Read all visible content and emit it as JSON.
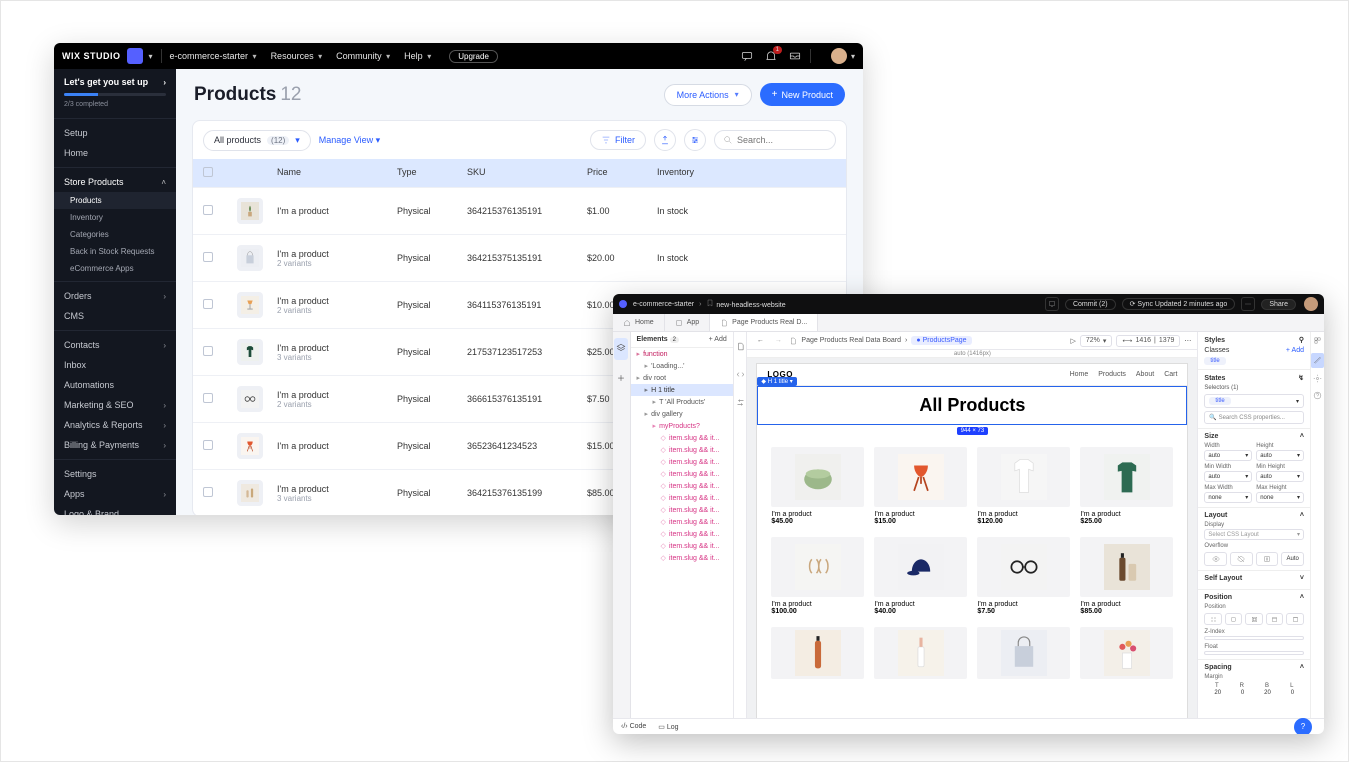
{
  "window1": {
    "topbar": {
      "logo": "WIX STUDIO",
      "project": "e-commerce-starter",
      "nav": [
        "Resources",
        "Community",
        "Help"
      ],
      "upgrade": "Upgrade",
      "notif_count": "1"
    },
    "sidebar": {
      "setup_title": "Let's get you set up",
      "setup_sub": "2/3 completed",
      "items_top": [
        "Setup",
        "Home"
      ],
      "store_products": "Store Products",
      "store_subs": [
        "Products",
        "Inventory",
        "Categories",
        "Back in Stock Requests",
        "eCommerce Apps"
      ],
      "orders": "Orders",
      "cms": "CMS",
      "group3": [
        "Contacts",
        "Inbox",
        "Automations",
        "Marketing & SEO",
        "Analytics & Reports",
        "Billing & Payments"
      ],
      "group4": [
        "Settings",
        "Apps",
        "Logo & Brand"
      ]
    },
    "main": {
      "title": "Products",
      "count": "12",
      "more_actions": "More Actions",
      "new_product": "New Product",
      "all_products": "All products",
      "all_products_count": "(12)",
      "manage_view": "Manage View",
      "filter": "Filter",
      "search_placeholder": "Search...",
      "columns": {
        "name": "Name",
        "type": "Type",
        "sku": "SKU",
        "price": "Price",
        "inventory": "Inventory"
      },
      "rows": [
        {
          "name": "I'm a product",
          "sub": "",
          "type": "Physical",
          "sku": "364215376135191",
          "price": "$1.00",
          "inv": "In stock",
          "thumb": "plant"
        },
        {
          "name": "I'm a product",
          "sub": "2 variants",
          "type": "Physical",
          "sku": "364215375135191",
          "price": "$20.00",
          "inv": "In stock",
          "thumb": "bag"
        },
        {
          "name": "I'm a product",
          "sub": "2 variants",
          "type": "Physical",
          "sku": "364115376135191",
          "price": "$10.00",
          "inv": "In stock",
          "thumb": "lamp"
        },
        {
          "name": "I'm a product",
          "sub": "3 variants",
          "type": "Physical",
          "sku": "217537123517253",
          "price": "$25.00",
          "inv": "",
          "thumb": "shirt"
        },
        {
          "name": "I'm a product",
          "sub": "2 variants",
          "type": "Physical",
          "sku": "366615376135191",
          "price": "$7.50",
          "inv": "",
          "thumb": "glasses"
        },
        {
          "name": "I'm a product",
          "sub": "",
          "type": "Physical",
          "sku": "36523641234523",
          "price": "$15.00",
          "inv": "",
          "thumb": "chair"
        },
        {
          "name": "I'm a product",
          "sub": "3 variants",
          "type": "Physical",
          "sku": "364215376135199",
          "price": "$85.00",
          "inv": "",
          "thumb": "bottles"
        }
      ]
    }
  },
  "window2": {
    "topbar": {
      "crumb1": "e-commerce-starter",
      "crumb2": "new-headless-website",
      "commit": "Commit (2)",
      "sync": "Sync Updated 2 minutes ago",
      "share": "Share"
    },
    "tabs": {
      "home": "Home",
      "app": "App",
      "page": "Page Products Real D..."
    },
    "tree": {
      "header": "Elements",
      "header_count": "2",
      "add": "+ Add",
      "items": [
        {
          "lvl": 0,
          "cls": "fn",
          "txt": "function"
        },
        {
          "lvl": 1,
          "cls": "div",
          "txt": "'Loading...'"
        },
        {
          "lvl": 0,
          "cls": "div",
          "txt": "div root"
        },
        {
          "lvl": 1,
          "cls": "sel",
          "txt": "H 1 title"
        },
        {
          "lvl": 2,
          "cls": "div",
          "txt": "T 'All Products'"
        },
        {
          "lvl": 1,
          "cls": "div",
          "txt": "div gallery"
        },
        {
          "lvl": 2,
          "cls": "pink",
          "txt": "myProducts?"
        },
        {
          "lvl": 3,
          "cls": "pink",
          "txt": "item.slug && it..."
        },
        {
          "lvl": 3,
          "cls": "pink",
          "txt": "item.slug && it..."
        },
        {
          "lvl": 3,
          "cls": "pink",
          "txt": "item.slug && it..."
        },
        {
          "lvl": 3,
          "cls": "pink",
          "txt": "item.slug && it..."
        },
        {
          "lvl": 3,
          "cls": "pink",
          "txt": "item.slug && it..."
        },
        {
          "lvl": 3,
          "cls": "pink",
          "txt": "item.slug && it..."
        },
        {
          "lvl": 3,
          "cls": "pink",
          "txt": "item.slug && it..."
        },
        {
          "lvl": 3,
          "cls": "pink",
          "txt": "item.slug && it..."
        },
        {
          "lvl": 3,
          "cls": "pink",
          "txt": "item.slug && it..."
        },
        {
          "lvl": 3,
          "cls": "pink",
          "txt": "item.slug && it..."
        },
        {
          "lvl": 3,
          "cls": "pink",
          "txt": "item.slug && it..."
        }
      ]
    },
    "crumbs": {
      "page": "Page Products Real Data Board",
      "chip": "ProductsPage",
      "zoom": "72%",
      "dims_w": "1416",
      "dims_h": "1379",
      "ruler": "auto (1416px)"
    },
    "canvas": {
      "sel_tag": "H 1 title",
      "logo": "LOGO",
      "nav": [
        "Home",
        "Products",
        "About",
        "Cart"
      ],
      "heading": "All Products",
      "dim_tag": "944 × 73",
      "products": [
        {
          "label": "I'm a product",
          "price": "$45.00",
          "kind": "pouf"
        },
        {
          "label": "I'm a product",
          "price": "$15.00",
          "kind": "chair"
        },
        {
          "label": "I'm a product",
          "price": "$120.00",
          "kind": "tshirt"
        },
        {
          "label": "I'm a product",
          "price": "$25.00",
          "kind": "sweater"
        },
        {
          "label": "I'm a product",
          "price": "$100.00",
          "kind": "earrings"
        },
        {
          "label": "I'm a product",
          "price": "$40.00",
          "kind": "cap"
        },
        {
          "label": "I'm a product",
          "price": "$7.50",
          "kind": "glasses"
        },
        {
          "label": "I'm a product",
          "price": "$85.00",
          "kind": "serum"
        }
      ],
      "products_row3_kinds": [
        "bottle",
        "dropper",
        "bag",
        "flowers"
      ]
    },
    "right": {
      "styles": "Styles",
      "classes": "Classes",
      "add": "+ Add",
      "class_chip": "title",
      "states": "States",
      "selectors": "Selectors (1)",
      "selector_chip": "title",
      "search": "Search CSS properties...",
      "size": "Size",
      "width": "Width",
      "height": "Height",
      "minwidth": "Min Width",
      "minheight": "Min Height",
      "maxwidth": "Max Width",
      "maxheight": "Max Height",
      "val_auto": "auto",
      "val_none": "none",
      "layout": "Layout",
      "display": "Display",
      "display_ph": "Select CSS Layout",
      "overflow": "Overflow",
      "overflow_auto": "Auto",
      "selflayout": "Self Layout",
      "position": "Position",
      "position_lbl": "Position",
      "zindex": "Z-Index",
      "float": "Float",
      "spacing": "Spacing",
      "margin": "Margin",
      "margin_labels": [
        "T",
        "R",
        "B",
        "L"
      ],
      "margin_vals": [
        "20",
        "0",
        "20",
        "0"
      ]
    },
    "footer": {
      "code": "Code",
      "log": "Log",
      "fab": "?"
    }
  }
}
